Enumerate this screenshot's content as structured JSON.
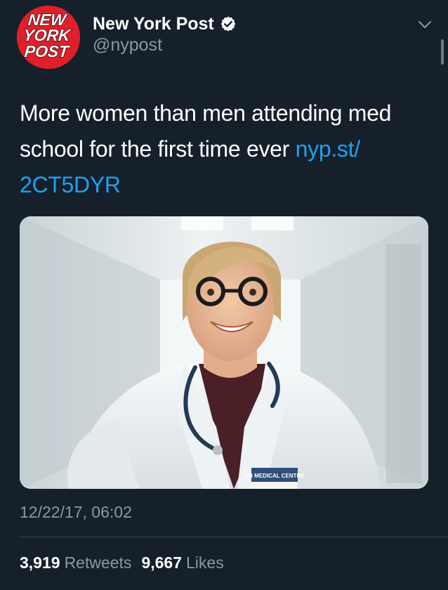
{
  "account": {
    "display_name": "New York Post",
    "handle": "@nypost",
    "avatar_text": [
      "NEW",
      "YORK",
      "POST"
    ],
    "verified": true
  },
  "tweet": {
    "text": "More women than men attending med school for the first time ever ",
    "link_text": "nyp.st/2CT5DYR",
    "link_line1": "nyp.st/",
    "link_line2": "2CT5DYR",
    "image_badge_text": "CB MEDICAL CENTRE",
    "timestamp": "12/22/17, 06:02"
  },
  "stats": {
    "retweets_count": "3,919",
    "retweets_label": "Retweets",
    "likes_count": "9,667",
    "likes_label": "Likes"
  },
  "icons": {
    "verified": "verified-badge-icon",
    "caret": "chevron-down-icon"
  },
  "colors": {
    "background": "#15202b",
    "link": "#1da1f2",
    "secondary_text": "#8899a6",
    "brand_red": "#e01f2a"
  }
}
